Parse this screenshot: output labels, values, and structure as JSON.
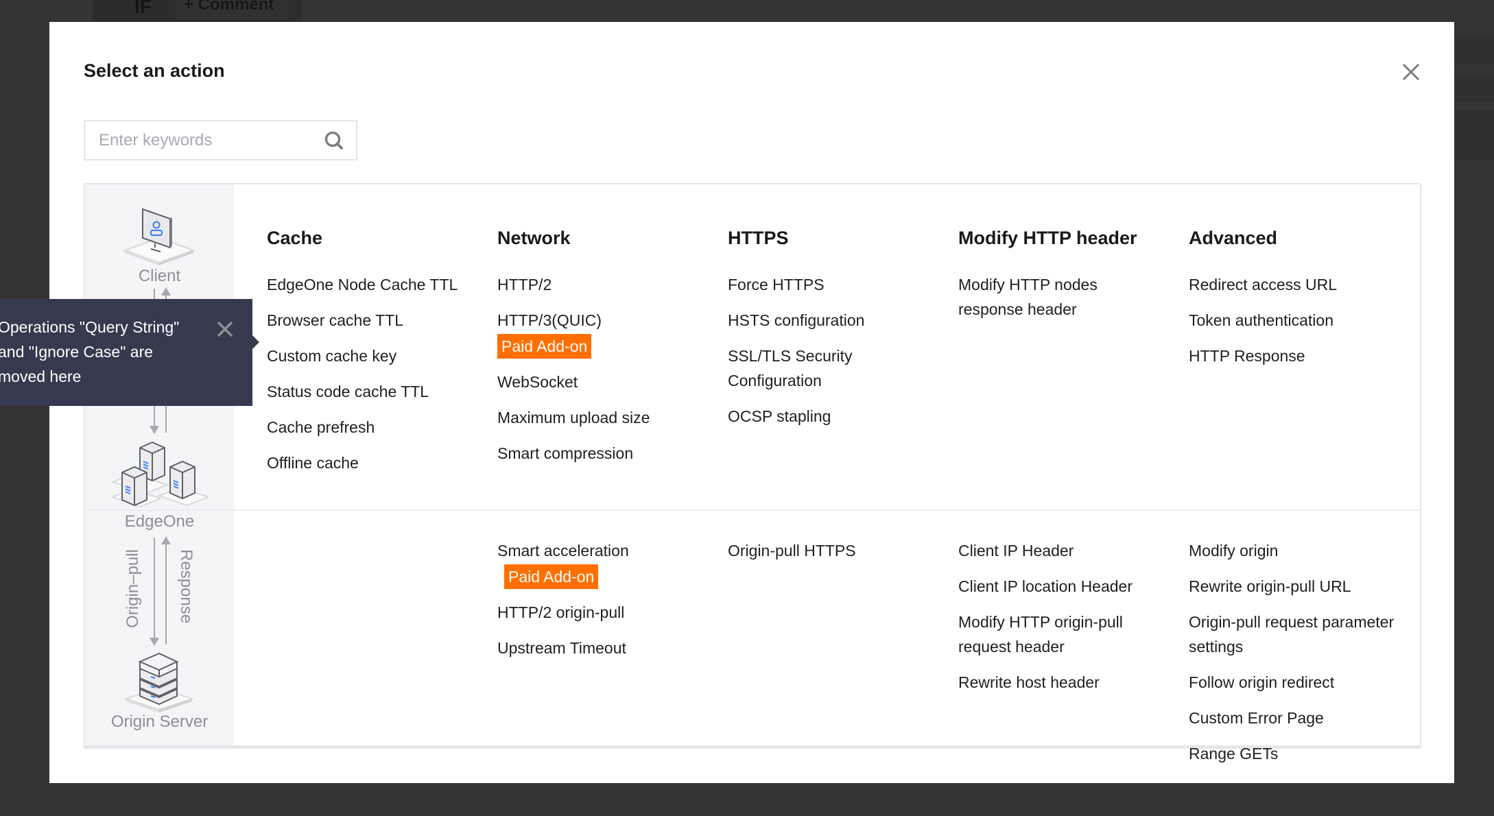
{
  "background": {
    "if_label": "IF",
    "comment_button": "+ Comment"
  },
  "modal": {
    "title": "Select an action",
    "close_icon": "close-icon",
    "search": {
      "placeholder": "Enter keywords",
      "value": "",
      "icon": "search-icon"
    }
  },
  "flow": {
    "client": "Client",
    "edgeone": "EdgeOne",
    "origin_pull": "Origin–pull",
    "response": "Response",
    "origin_server": "Origin Server"
  },
  "tooltip": {
    "text_line1": "Operations \"Query String\"",
    "text_line2": "and \"Ignore Case\" are",
    "text_line3": "moved here",
    "close_icon": "close-icon"
  },
  "badge_color": "#ff6f00",
  "columns": [
    {
      "header": "Cache",
      "top_items": [
        {
          "label": "EdgeOne Node Cache TTL"
        },
        {
          "label": "Browser cache TTL"
        },
        {
          "label": "Custom cache key"
        },
        {
          "label": "Status code cache TTL"
        },
        {
          "label": "Cache prefresh"
        },
        {
          "label": "Offline cache"
        }
      ],
      "bottom_items": []
    },
    {
      "header": "Network",
      "top_items": [
        {
          "label": "HTTP/2"
        },
        {
          "label": "HTTP/3(QUIC)",
          "badge": "Paid Add-on"
        },
        {
          "label": "WebSocket"
        },
        {
          "label": "Maximum upload size"
        },
        {
          "label": "Smart compression"
        }
      ],
      "bottom_items": [
        {
          "label": "Smart acceleration",
          "badge": "Paid Add-on"
        },
        {
          "label": "HTTP/2 origin-pull"
        },
        {
          "label": "Upstream Timeout"
        }
      ]
    },
    {
      "header": "HTTPS",
      "top_items": [
        {
          "label": "Force HTTPS"
        },
        {
          "label": "HSTS configuration"
        },
        {
          "label": "SSL/TLS Security Configuration"
        },
        {
          "label": "OCSP stapling"
        }
      ],
      "bottom_items": [
        {
          "label": "Origin-pull HTTPS"
        }
      ]
    },
    {
      "header": "Modify HTTP header",
      "top_items": [
        {
          "label": "Modify HTTP nodes response header"
        }
      ],
      "bottom_items": [
        {
          "label": "Client IP Header"
        },
        {
          "label": "Client IP location Header"
        },
        {
          "label": "Modify HTTP origin-pull request header"
        },
        {
          "label": "Rewrite host header"
        }
      ]
    },
    {
      "header": "Advanced",
      "top_items": [
        {
          "label": "Redirect access URL"
        },
        {
          "label": "Token authentication"
        },
        {
          "label": "HTTP Response"
        }
      ],
      "bottom_items": [
        {
          "label": "Modify origin"
        },
        {
          "label": "Rewrite origin-pull URL"
        },
        {
          "label": "Origin-pull request parameter settings"
        },
        {
          "label": "Follow origin redirect"
        },
        {
          "label": "Custom Error Page"
        },
        {
          "label": "Range GETs"
        }
      ]
    }
  ]
}
